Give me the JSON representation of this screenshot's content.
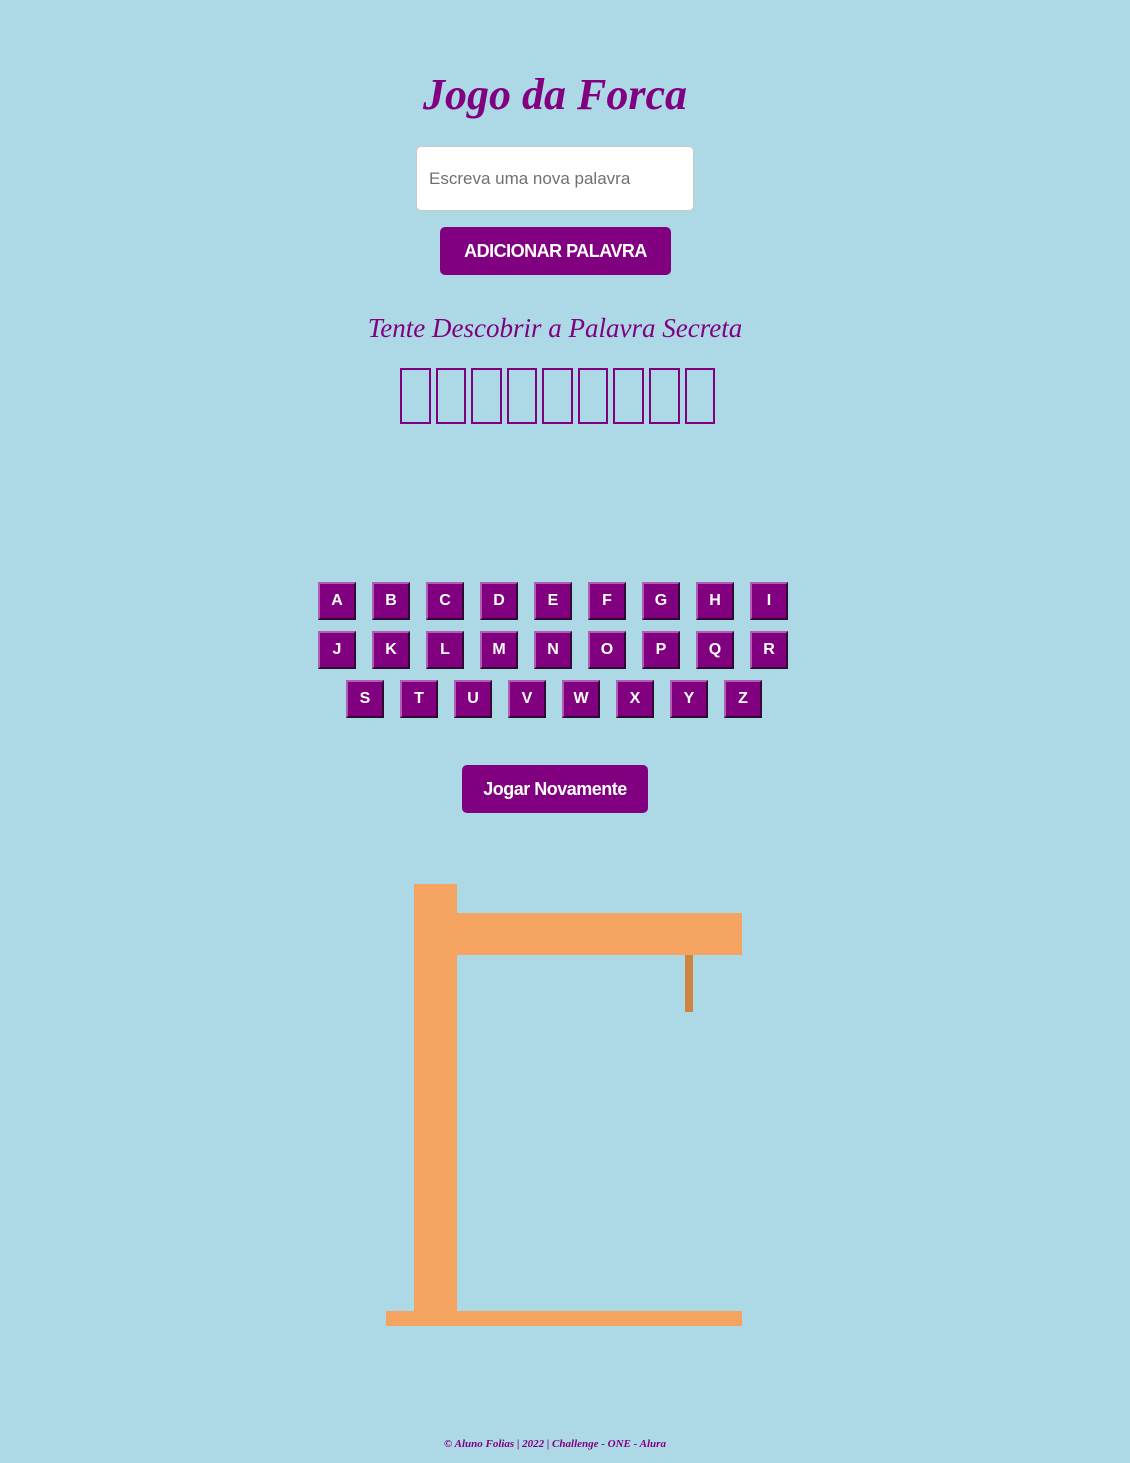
{
  "header": {
    "title": "Jogo da Forca"
  },
  "add_word": {
    "placeholder": "Escreva uma nova palavra",
    "value": "",
    "button_label": "ADICIONAR PALAVRA"
  },
  "game": {
    "subtitle": "Tente Descobrir a Palavra Secreta",
    "secret_word_length": 9,
    "restart_label": "Jogar Novamente"
  },
  "keyboard": {
    "rows": [
      [
        "A",
        "B",
        "C",
        "D",
        "E",
        "F",
        "G",
        "H",
        "I"
      ],
      [
        "J",
        "K",
        "L",
        "M",
        "N",
        "O",
        "P",
        "Q",
        "R"
      ],
      [
        "S",
        "T",
        "U",
        "V",
        "W",
        "X",
        "Y",
        "Z"
      ]
    ]
  },
  "gallows": {
    "color": "#f4a460",
    "rope_color": "#cd853f",
    "parts_drawn": [
      "base",
      "post",
      "beam",
      "rope"
    ]
  },
  "footer": {
    "text": "© Aluno Folias | 2022 | Challenge - ONE - Alura"
  },
  "colors": {
    "background": "#add8e6",
    "accent": "#800080"
  }
}
